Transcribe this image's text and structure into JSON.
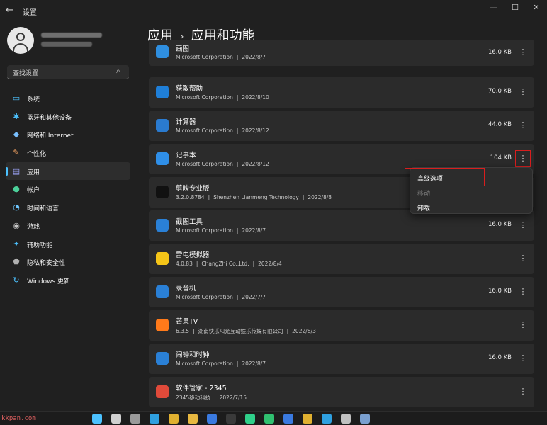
{
  "window": {
    "title": "设置",
    "back_icon": "←",
    "min_icon": "—",
    "max_icon": "☐",
    "close_icon": "✕"
  },
  "sidebar": {
    "search_placeholder": "查找设置",
    "search_icon": "⌕",
    "items": [
      {
        "label": "系统",
        "icon": "system-icon",
        "glyph": "▭",
        "color": "#4cc2ff"
      },
      {
        "label": "蓝牙和其他设备",
        "icon": "bluetooth-icon",
        "glyph": "✱",
        "color": "#4cc2ff"
      },
      {
        "label": "网络和 Internet",
        "icon": "wifi-icon",
        "glyph": "◆",
        "color": "#7ac0ff"
      },
      {
        "label": "个性化",
        "icon": "brush-icon",
        "glyph": "✎",
        "color": "#f0a060"
      },
      {
        "label": "应用",
        "icon": "apps-icon",
        "glyph": "▤",
        "color": "#a0a8ff",
        "active": true
      },
      {
        "label": "帐户",
        "icon": "account-icon",
        "glyph": "●",
        "color": "#4cd09a"
      },
      {
        "label": "时间和语言",
        "icon": "globe-icon",
        "glyph": "◔",
        "color": "#6fc8ff"
      },
      {
        "label": "游戏",
        "icon": "gamepad-icon",
        "glyph": "◉",
        "color": "#c8c8c8"
      },
      {
        "label": "辅助功能",
        "icon": "accessibility-icon",
        "glyph": "✦",
        "color": "#4cc2ff"
      },
      {
        "label": "隐私和安全性",
        "icon": "shield-icon",
        "glyph": "⬟",
        "color": "#b0b0b0"
      },
      {
        "label": "Windows 更新",
        "icon": "update-icon",
        "glyph": "↻",
        "color": "#4cc2ff"
      }
    ]
  },
  "breadcrumb": {
    "parent": "应用",
    "separator": "›",
    "current": "应用和功能"
  },
  "apps": [
    {
      "name": "画图",
      "publisher": "Microsoft Corporation",
      "date": "2022/8/7",
      "size": "16.0 KB",
      "icon": "paint-icon",
      "color": "#2f8fe0"
    },
    {
      "name": "获取帮助",
      "publisher": "Microsoft Corporation",
      "date": "2022/8/10",
      "size": "70.0 KB",
      "icon": "help-icon",
      "color": "#1f7fd8"
    },
    {
      "name": "计算器",
      "publisher": "Microsoft Corporation",
      "date": "2022/8/12",
      "size": "44.0 KB",
      "icon": "calculator-icon",
      "color": "#2a7bd0"
    },
    {
      "name": "记事本",
      "publisher": "Microsoft Corporation",
      "date": "2022/8/12",
      "size": "104 KB",
      "icon": "notepad-icon",
      "color": "#2f8fe8",
      "menu_open": true
    },
    {
      "name": "剪映专业版",
      "publisher": "Shenzhen Lianmeng Technology",
      "version": "3.2.0.8784",
      "date": "2022/8/8",
      "size": "",
      "icon": "capcut-icon",
      "color": "#111111"
    },
    {
      "name": "截图工具",
      "publisher": "Microsoft Corporation",
      "date": "2022/8/7",
      "size": "16.0 KB",
      "icon": "snipping-icon",
      "color": "#2a80d6"
    },
    {
      "name": "雷电模拟器",
      "publisher": "ChangZhi Co.,Ltd.",
      "version": "4.0.83",
      "date": "2022/8/4",
      "size": "",
      "icon": "ldplayer-icon",
      "color": "#f5c518"
    },
    {
      "name": "录音机",
      "publisher": "Microsoft Corporation",
      "date": "2022/7/7",
      "size": "16.0 KB",
      "icon": "recorder-icon",
      "color": "#2a80d6"
    },
    {
      "name": "芒果TV",
      "publisher": "湖南快乐阳光互动娱乐传媒有限公司",
      "version": "6.3.5",
      "date": "2022/8/3",
      "size": "",
      "icon": "mangotv-icon",
      "color": "#ff7a1a"
    },
    {
      "name": "闹钟和时钟",
      "publisher": "Microsoft Corporation",
      "date": "2022/8/7",
      "size": "16.0 KB",
      "icon": "clock-icon",
      "color": "#2a80d6"
    },
    {
      "name": "软件管家 - 2345",
      "publisher": "2345移动科技",
      "date": "2022/7/15",
      "size": "",
      "icon": "2345-icon",
      "color": "#e04a3a"
    }
  ],
  "meta_separator": "|",
  "more_glyph": "⋮",
  "context_menu": {
    "items": [
      {
        "label": "高级选项",
        "enabled": true
      },
      {
        "label": "移动",
        "enabled": false
      },
      {
        "label": "卸载",
        "enabled": true
      }
    ]
  },
  "watermark_left": "kkpan.com",
  "taskbar_icons": [
    "windows-start-icon",
    "search-icon",
    "task-view-icon",
    "edge-icon",
    "chrome-icon",
    "file-explorer-icon",
    "feishu-icon",
    "terminal-icon",
    "webstorm-icon",
    "pycharm-icon",
    "feishu-icon",
    "chrome-icon",
    "edge-icon",
    "gear-icon",
    "settings-icon"
  ]
}
